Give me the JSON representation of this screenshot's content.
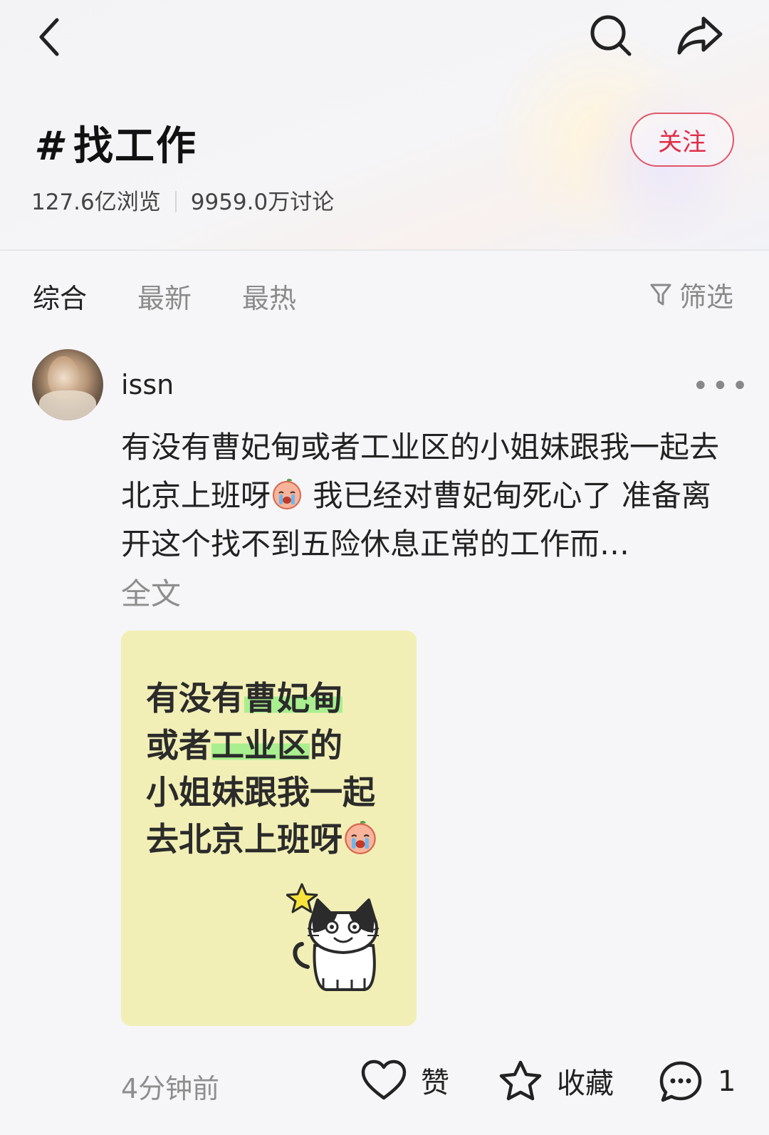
{
  "header": {
    "back_icon": "chevron-left-icon",
    "search_icon": "search-icon",
    "share_icon": "share-arrow-icon",
    "hash_symbol": "#",
    "topic": "找工作",
    "views": "127.6亿浏览",
    "discussions": "9959.0万讨论",
    "follow_label": "关注",
    "accent_color": "#e02d48"
  },
  "tabs": [
    {
      "label": "综合",
      "active": true
    },
    {
      "label": "最新",
      "active": false
    },
    {
      "label": "最热",
      "active": false
    }
  ],
  "filter": {
    "label": "筛选",
    "icon": "funnel-icon"
  },
  "post": {
    "username": "issn",
    "more_icon": "more-dots-icon",
    "text_part1": "有没有曹妃甸或者工业区的小姐妹跟我一起去北京上班呀",
    "text_part2": " 我已经对曹妃甸死心了 准备离开这个找不到五险休息正常的工作而…",
    "emoji_icon": "crying-face-emoji",
    "full_text_label": "全文",
    "image": {
      "line1_plain": "有没有",
      "line1_hl": "曹妃甸",
      "line2_plain_a": "或者",
      "line2_hl": "工业区",
      "line2_plain_b": "的",
      "line3": "小姐妹跟我一起",
      "line4": "去北京上班呀",
      "background_color": "#f2efb6",
      "highlight_color": "#a9ee8f",
      "illustration": "cat-with-star-icon"
    },
    "time": "4分钟前",
    "like_label": "赞",
    "favorite_label": "收藏",
    "comment_count": "1",
    "like_icon": "heart-icon",
    "favorite_icon": "star-icon",
    "comment_icon": "comment-bubble-icon"
  }
}
